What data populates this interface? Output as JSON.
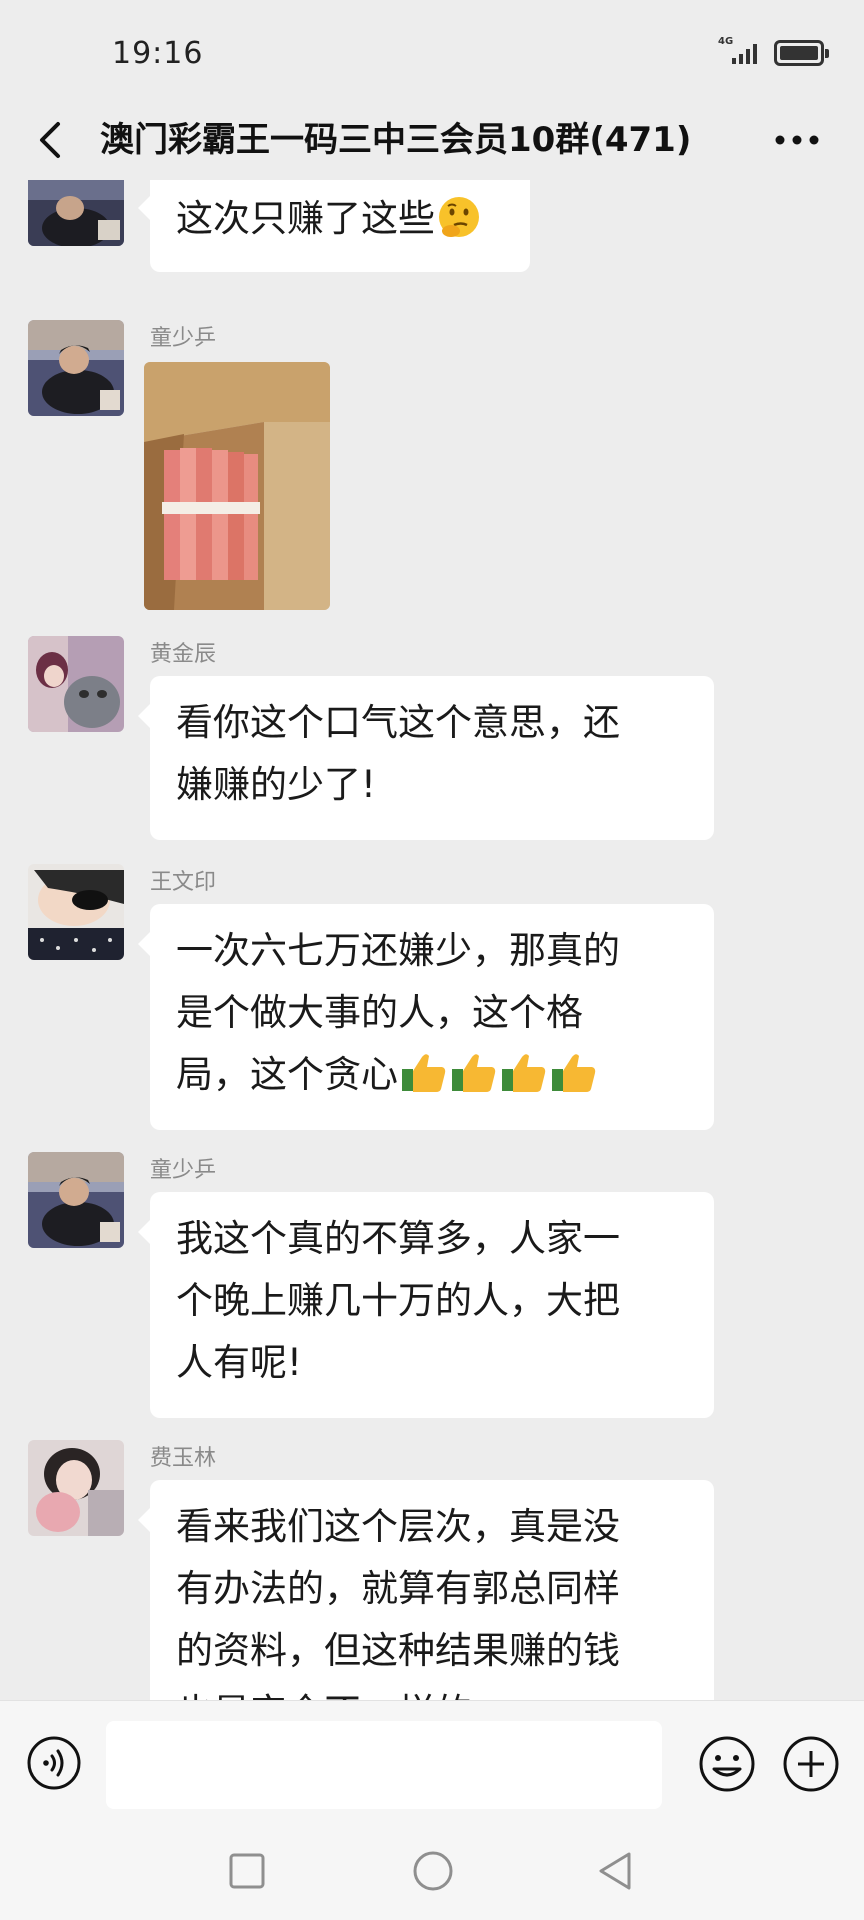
{
  "status_bar": {
    "time": "19:16",
    "network": "4G"
  },
  "header": {
    "title": "澳门彩霸王一码三中三会员10群(471)"
  },
  "messages": [
    {
      "sender": "",
      "text": "这次只赚了这些",
      "emoji": "thinking-face"
    },
    {
      "sender": "童少乒",
      "type": "image",
      "image_desc": "box-of-cash"
    },
    {
      "sender": "黄金辰",
      "lines": [
        "看你这个口气这个意思，还",
        "嫌赚的少了!"
      ]
    },
    {
      "sender": "王文印",
      "lines": [
        "一次六七万还嫌少，那真的",
        "是个做大事的人，这个格",
        "局，这个贪心"
      ],
      "emoji_count": 4
    },
    {
      "sender": "童少乒",
      "lines": [
        "我这个真的不算多，人家一",
        "个晚上赚几十万的人，大把",
        "人有呢!"
      ]
    },
    {
      "sender": "费玉林",
      "lines": [
        "看来我们这个层次，真是没",
        "有办法的，就算有郭总同样",
        "的资料，但这种结果赚的钱",
        "也是完全不一样的"
      ]
    }
  ],
  "input": {
    "value": "",
    "placeholder": ""
  },
  "colors": {
    "background": "#ededed",
    "bubble": "#ffffff",
    "sender_name": "#8a8a8a"
  },
  "icons": {
    "back": "back-icon",
    "more": "more-icon",
    "voice": "voice-icon",
    "emoji": "emoji-icon",
    "plus": "plus-icon"
  }
}
